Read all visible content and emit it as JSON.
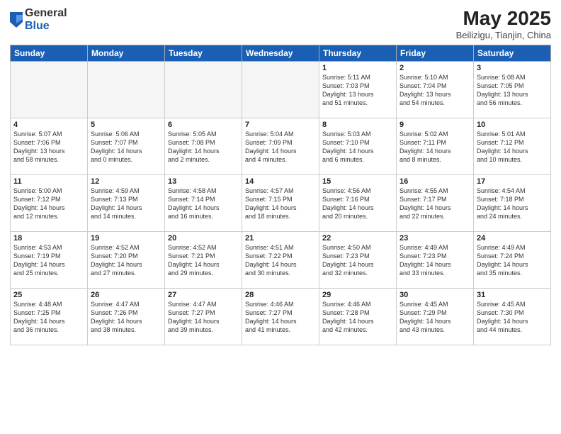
{
  "header": {
    "logo_general": "General",
    "logo_blue": "Blue",
    "title": "May 2025",
    "location": "Beilizigu, Tianjin, China"
  },
  "weekdays": [
    "Sunday",
    "Monday",
    "Tuesday",
    "Wednesday",
    "Thursday",
    "Friday",
    "Saturday"
  ],
  "weeks": [
    [
      {
        "day": "",
        "info": ""
      },
      {
        "day": "",
        "info": ""
      },
      {
        "day": "",
        "info": ""
      },
      {
        "day": "",
        "info": ""
      },
      {
        "day": "1",
        "info": "Sunrise: 5:11 AM\nSunset: 7:03 PM\nDaylight: 13 hours\nand 51 minutes."
      },
      {
        "day": "2",
        "info": "Sunrise: 5:10 AM\nSunset: 7:04 PM\nDaylight: 13 hours\nand 54 minutes."
      },
      {
        "day": "3",
        "info": "Sunrise: 5:08 AM\nSunset: 7:05 PM\nDaylight: 13 hours\nand 56 minutes."
      }
    ],
    [
      {
        "day": "4",
        "info": "Sunrise: 5:07 AM\nSunset: 7:06 PM\nDaylight: 13 hours\nand 58 minutes."
      },
      {
        "day": "5",
        "info": "Sunrise: 5:06 AM\nSunset: 7:07 PM\nDaylight: 14 hours\nand 0 minutes."
      },
      {
        "day": "6",
        "info": "Sunrise: 5:05 AM\nSunset: 7:08 PM\nDaylight: 14 hours\nand 2 minutes."
      },
      {
        "day": "7",
        "info": "Sunrise: 5:04 AM\nSunset: 7:09 PM\nDaylight: 14 hours\nand 4 minutes."
      },
      {
        "day": "8",
        "info": "Sunrise: 5:03 AM\nSunset: 7:10 PM\nDaylight: 14 hours\nand 6 minutes."
      },
      {
        "day": "9",
        "info": "Sunrise: 5:02 AM\nSunset: 7:11 PM\nDaylight: 14 hours\nand 8 minutes."
      },
      {
        "day": "10",
        "info": "Sunrise: 5:01 AM\nSunset: 7:12 PM\nDaylight: 14 hours\nand 10 minutes."
      }
    ],
    [
      {
        "day": "11",
        "info": "Sunrise: 5:00 AM\nSunset: 7:12 PM\nDaylight: 14 hours\nand 12 minutes."
      },
      {
        "day": "12",
        "info": "Sunrise: 4:59 AM\nSunset: 7:13 PM\nDaylight: 14 hours\nand 14 minutes."
      },
      {
        "day": "13",
        "info": "Sunrise: 4:58 AM\nSunset: 7:14 PM\nDaylight: 14 hours\nand 16 minutes."
      },
      {
        "day": "14",
        "info": "Sunrise: 4:57 AM\nSunset: 7:15 PM\nDaylight: 14 hours\nand 18 minutes."
      },
      {
        "day": "15",
        "info": "Sunrise: 4:56 AM\nSunset: 7:16 PM\nDaylight: 14 hours\nand 20 minutes."
      },
      {
        "day": "16",
        "info": "Sunrise: 4:55 AM\nSunset: 7:17 PM\nDaylight: 14 hours\nand 22 minutes."
      },
      {
        "day": "17",
        "info": "Sunrise: 4:54 AM\nSunset: 7:18 PM\nDaylight: 14 hours\nand 24 minutes."
      }
    ],
    [
      {
        "day": "18",
        "info": "Sunrise: 4:53 AM\nSunset: 7:19 PM\nDaylight: 14 hours\nand 25 minutes."
      },
      {
        "day": "19",
        "info": "Sunrise: 4:52 AM\nSunset: 7:20 PM\nDaylight: 14 hours\nand 27 minutes."
      },
      {
        "day": "20",
        "info": "Sunrise: 4:52 AM\nSunset: 7:21 PM\nDaylight: 14 hours\nand 29 minutes."
      },
      {
        "day": "21",
        "info": "Sunrise: 4:51 AM\nSunset: 7:22 PM\nDaylight: 14 hours\nand 30 minutes."
      },
      {
        "day": "22",
        "info": "Sunrise: 4:50 AM\nSunset: 7:23 PM\nDaylight: 14 hours\nand 32 minutes."
      },
      {
        "day": "23",
        "info": "Sunrise: 4:49 AM\nSunset: 7:23 PM\nDaylight: 14 hours\nand 33 minutes."
      },
      {
        "day": "24",
        "info": "Sunrise: 4:49 AM\nSunset: 7:24 PM\nDaylight: 14 hours\nand 35 minutes."
      }
    ],
    [
      {
        "day": "25",
        "info": "Sunrise: 4:48 AM\nSunset: 7:25 PM\nDaylight: 14 hours\nand 36 minutes."
      },
      {
        "day": "26",
        "info": "Sunrise: 4:47 AM\nSunset: 7:26 PM\nDaylight: 14 hours\nand 38 minutes."
      },
      {
        "day": "27",
        "info": "Sunrise: 4:47 AM\nSunset: 7:27 PM\nDaylight: 14 hours\nand 39 minutes."
      },
      {
        "day": "28",
        "info": "Sunrise: 4:46 AM\nSunset: 7:27 PM\nDaylight: 14 hours\nand 41 minutes."
      },
      {
        "day": "29",
        "info": "Sunrise: 4:46 AM\nSunset: 7:28 PM\nDaylight: 14 hours\nand 42 minutes."
      },
      {
        "day": "30",
        "info": "Sunrise: 4:45 AM\nSunset: 7:29 PM\nDaylight: 14 hours\nand 43 minutes."
      },
      {
        "day": "31",
        "info": "Sunrise: 4:45 AM\nSunset: 7:30 PM\nDaylight: 14 hours\nand 44 minutes."
      }
    ]
  ]
}
